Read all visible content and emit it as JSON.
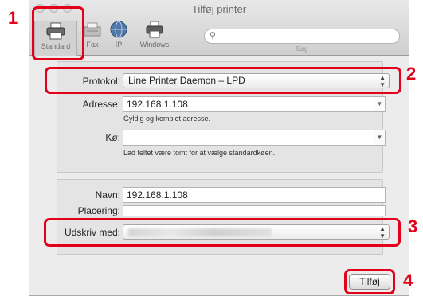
{
  "window": {
    "title": "Tilføj printer"
  },
  "toolbar": {
    "items": [
      {
        "label": "Standard",
        "icon": "printer-icon"
      },
      {
        "label": "Fax",
        "icon": "fax-icon"
      },
      {
        "label": "IP",
        "icon": "globe-icon"
      },
      {
        "label": "Windows",
        "icon": "windows-printer-icon"
      }
    ],
    "search_placeholder": "",
    "search_label": "Søg"
  },
  "form": {
    "protocol": {
      "label": "Protokol:",
      "value": "Line Printer Daemon – LPD"
    },
    "address": {
      "label": "Adresse:",
      "value": "192.168.1.108",
      "hint": "Gyldig og komplet adresse."
    },
    "queue": {
      "label": "Kø:",
      "value": "",
      "hint": "Lad feltet være tomt for at vælge standardkøen."
    },
    "name": {
      "label": "Navn:",
      "value": "192.168.1.108"
    },
    "location": {
      "label": "Placering:",
      "value": ""
    },
    "print_with": {
      "label": "Udskriv med:",
      "value": ""
    }
  },
  "buttons": {
    "add": "Tilføj"
  },
  "callouts": [
    "1",
    "2",
    "3",
    "4"
  ],
  "colors": {
    "highlight": "#e2001a"
  }
}
